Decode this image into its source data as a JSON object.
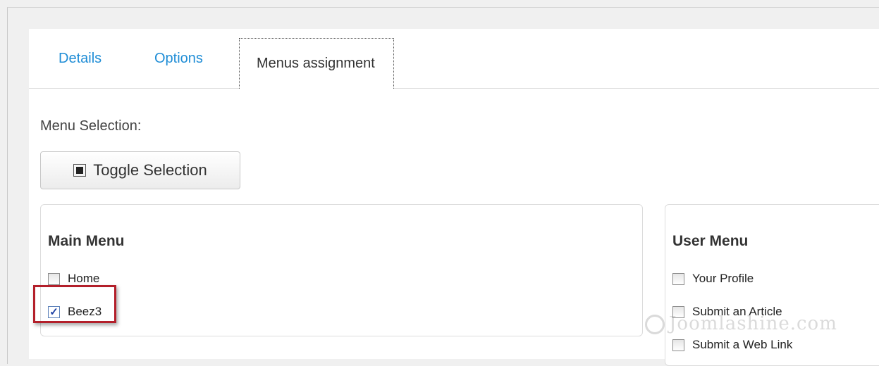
{
  "tabs": [
    {
      "label": "Details"
    },
    {
      "label": "Options"
    },
    {
      "label": "Menus assignment"
    }
  ],
  "menu_selection_label": "Menu Selection:",
  "toggle_button_label": "Toggle Selection",
  "main_menu": {
    "title": "Main Menu",
    "items": [
      {
        "label": "Home",
        "checked": false
      },
      {
        "label": "Beez3",
        "checked": true
      }
    ]
  },
  "user_menu": {
    "title": "User Menu",
    "items": [
      {
        "label": "Your Profile",
        "checked": false
      },
      {
        "label": "Submit an Article",
        "checked": false
      },
      {
        "label": "Submit a Web Link",
        "checked": false
      }
    ]
  },
  "watermark": "Joomlashine.com",
  "colors": {
    "tab_link": "#1f8dd6",
    "highlight_border": "#b31f2a"
  }
}
